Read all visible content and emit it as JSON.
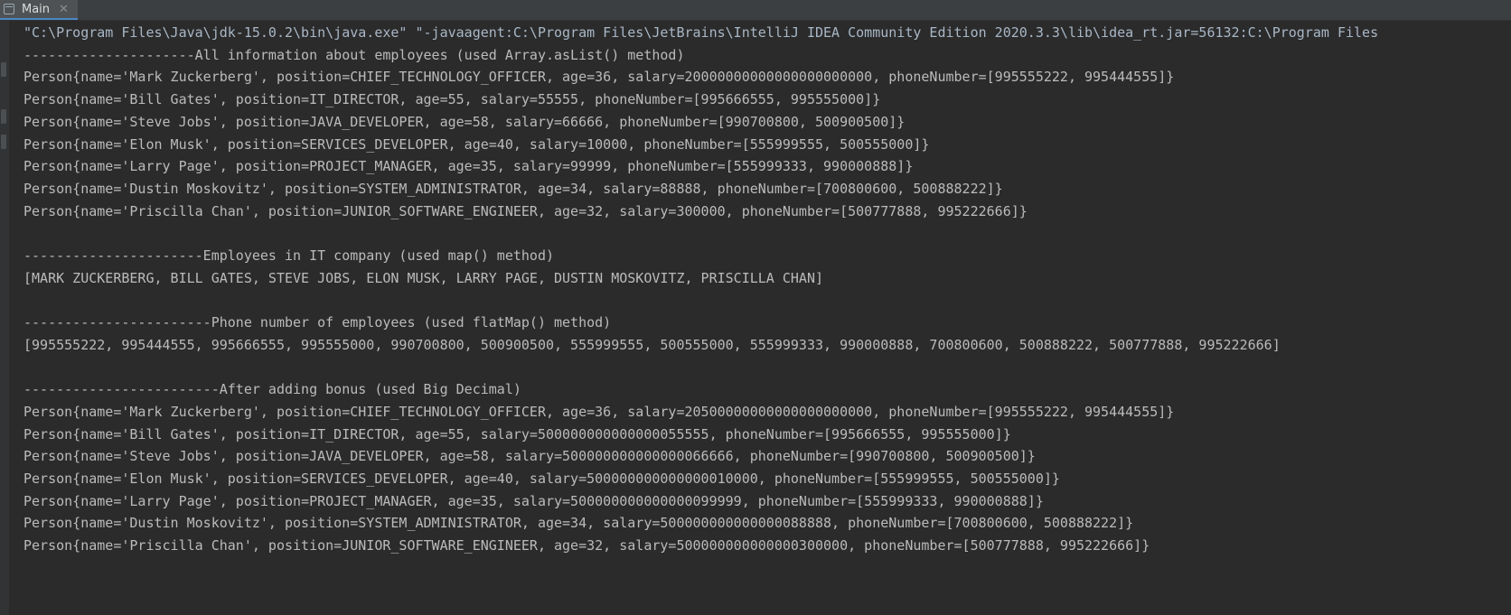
{
  "tab": {
    "label": "Main",
    "close": "✕",
    "icon": "console-icon"
  },
  "colors": {
    "background": "#2b2b2b",
    "text": "#bbbbbb",
    "tab_bg": "#4e5254",
    "tab_accent": "#4a88c7"
  },
  "console": {
    "lines": [
      "\"C:\\Program Files\\Java\\jdk-15.0.2\\bin\\java.exe\" \"-javaagent:C:\\Program Files\\JetBrains\\IntelliJ IDEA Community Edition 2020.3.3\\lib\\idea_rt.jar=56132:C:\\Program Files",
      "---------------------All information about employees (used Array.asList() method)",
      "Person{name='Mark Zuckerberg', position=CHIEF_TECHNOLOGY_OFFICER, age=36, salary=20000000000000000000000, phoneNumber=[995555222, 995444555]}",
      "Person{name='Bill Gates', position=IT_DIRECTOR, age=55, salary=55555, phoneNumber=[995666555, 995555000]}",
      "Person{name='Steve Jobs', position=JAVA_DEVELOPER, age=58, salary=66666, phoneNumber=[990700800, 500900500]}",
      "Person{name='Elon Musk', position=SERVICES_DEVELOPER, age=40, salary=10000, phoneNumber=[555999555, 500555000]}",
      "Person{name='Larry Page', position=PROJECT_MANAGER, age=35, salary=99999, phoneNumber=[555999333, 990000888]}",
      "Person{name='Dustin Moskovitz', position=SYSTEM_ADMINISTRATOR, age=34, salary=88888, phoneNumber=[700800600, 500888222]}",
      "Person{name='Priscilla Chan', position=JUNIOR_SOFTWARE_ENGINEER, age=32, salary=300000, phoneNumber=[500777888, 995222666]}",
      "",
      "----------------------Employees in IT company (used map() method)",
      "[MARK ZUCKERBERG, BILL GATES, STEVE JOBS, ELON MUSK, LARRY PAGE, DUSTIN MOSKOVITZ, PRISCILLA CHAN]",
      "",
      "-----------------------Phone number of employees (used flatMap() method)",
      "[995555222, 995444555, 995666555, 995555000, 990700800, 500900500, 555999555, 500555000, 555999333, 990000888, 700800600, 500888222, 500777888, 995222666]",
      "",
      "------------------------After adding bonus (used Big Decimal)",
      "Person{name='Mark Zuckerberg', position=CHIEF_TECHNOLOGY_OFFICER, age=36, salary=20500000000000000000000, phoneNumber=[995555222, 995444555]}",
      "Person{name='Bill Gates', position=IT_DIRECTOR, age=55, salary=500000000000000055555, phoneNumber=[995666555, 995555000]}",
      "Person{name='Steve Jobs', position=JAVA_DEVELOPER, age=58, salary=500000000000000066666, phoneNumber=[990700800, 500900500]}",
      "Person{name='Elon Musk', position=SERVICES_DEVELOPER, age=40, salary=500000000000000010000, phoneNumber=[555999555, 500555000]}",
      "Person{name='Larry Page', position=PROJECT_MANAGER, age=35, salary=500000000000000099999, phoneNumber=[555999333, 990000888]}",
      "Person{name='Dustin Moskovitz', position=SYSTEM_ADMINISTRATOR, age=34, salary=500000000000000088888, phoneNumber=[700800600, 500888222]}",
      "Person{name='Priscilla Chan', position=JUNIOR_SOFTWARE_ENGINEER, age=32, salary=500000000000000300000, phoneNumber=[500777888, 995222666]}"
    ]
  }
}
